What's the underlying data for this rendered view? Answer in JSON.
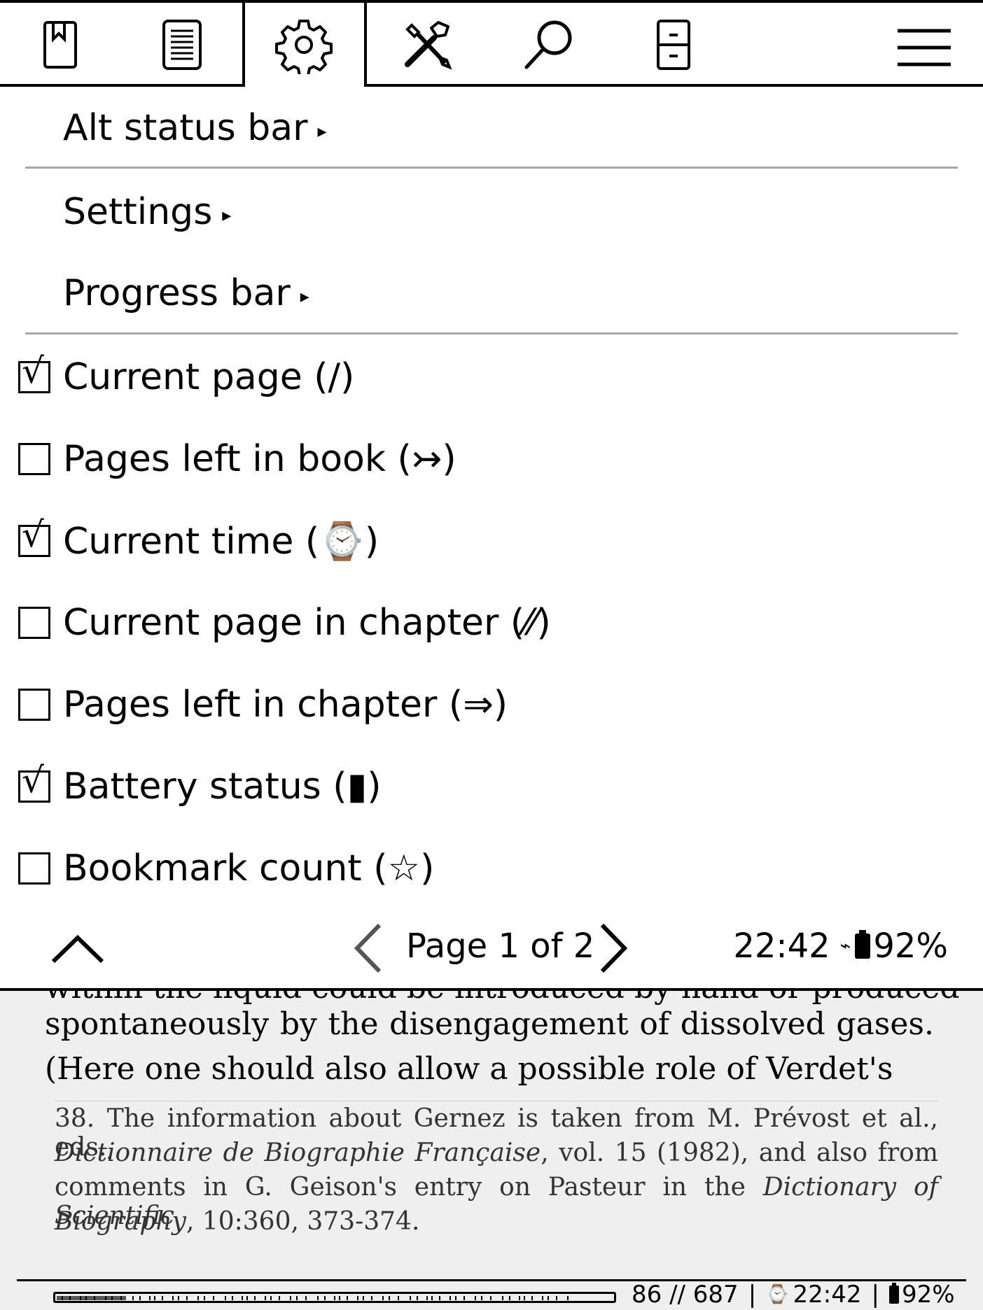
{
  "tabs": [
    {
      "icon": "bookmark-icon"
    },
    {
      "icon": "document-icon"
    },
    {
      "icon": "gear-icon",
      "active": true
    },
    {
      "icon": "tools-icon"
    },
    {
      "icon": "search-icon"
    },
    {
      "icon": "cabinet-icon"
    }
  ],
  "menu_icon": "hamburger-menu-icon",
  "submenus": {
    "alt_status_bar": "Alt status bar",
    "settings": "Settings",
    "progress_bar": "Progress bar",
    "arrow": "▸"
  },
  "options": [
    {
      "label": "Current page (/)",
      "checked": true
    },
    {
      "label": "Pages left in book (↣)",
      "checked": false
    },
    {
      "label": "Current time (⌚)",
      "checked": true
    },
    {
      "label": "Current page in chapter (⁄⁄)",
      "checked": false
    },
    {
      "label": "Pages left in chapter (⇒)",
      "checked": false
    },
    {
      "label": "Battery status (▮)",
      "checked": true
    },
    {
      "label": "Bookmark count (☆)",
      "checked": false
    }
  ],
  "check_mark": "√",
  "pager": {
    "page_label": "Page 1 of 2",
    "time": "22:42",
    "battery": "92%"
  },
  "reader": {
    "clipped_line": "within the liquid could be introduced by hand or produced",
    "line1": "spontaneously by the disengagement of dissolved gases.",
    "line2": "(Here one should also allow a possible role of Verdet's",
    "footnote": {
      "l1": "38. The information about Gernez is taken from M. Prévost et al., eds.,",
      "l2_italic": "Dictionnaire de Biographie Française",
      "l2_rest": ", vol. 15 (1982), and also from",
      "l3_start": "comments in G. Geison's entry on Pasteur in the ",
      "l3_italic": "Dictionary of Scientific",
      "l4_italic": "Biography",
      "l4_rest": ", 10:360, 373-374."
    }
  },
  "status": {
    "pages": "86 // 687",
    "sep": "|",
    "time": "22:42",
    "battery": "92%",
    "progress_fraction": 0.125
  }
}
